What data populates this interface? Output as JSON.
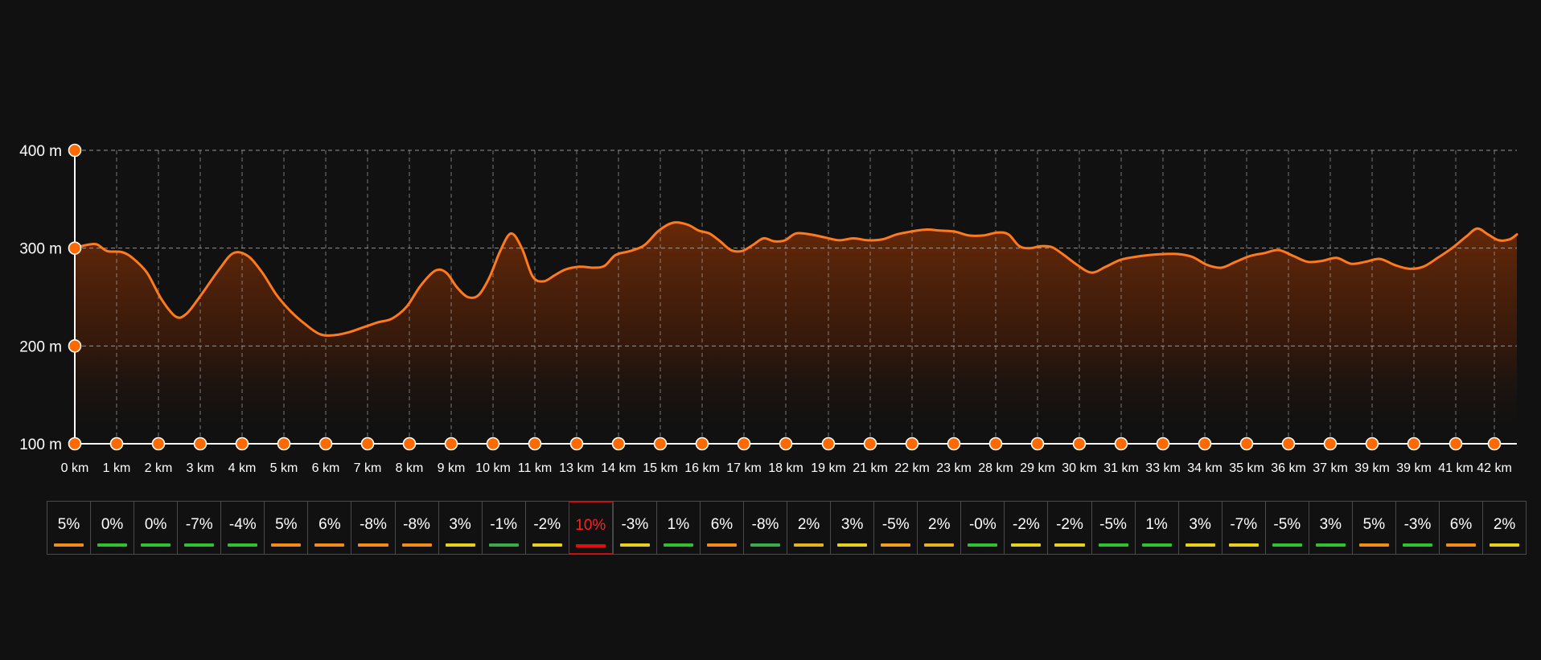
{
  "colors": {
    "background": "#111111",
    "line": "#ff7a1a",
    "marker": "#ff6a00",
    "grid": "#bdbdbd"
  },
  "chart_data": {
    "type": "area",
    "x_unit": "km",
    "y_unit": "m",
    "ylim": [
      100,
      400
    ],
    "y_ticks": [
      100,
      200,
      300,
      400
    ],
    "y_tick_labels": [
      "100 m",
      "200 m",
      "300 m",
      "400 m"
    ],
    "x_tick_labels": [
      "0 km",
      "1 km",
      "2 km",
      "3 km",
      "4 km",
      "5 km",
      "6 km",
      "7 km",
      "8 km",
      "9 km",
      "10 km",
      "11 km",
      "13 km",
      "14 km",
      "15 km",
      "16 km",
      "17 km",
      "18 km",
      "19 km",
      "21 km",
      "22 km",
      "23 km",
      "28 km",
      "29 km",
      "30 km",
      "31 km",
      "33 km",
      "34 km",
      "35 km",
      "36 km",
      "37 km",
      "39 km",
      "39 km",
      "41 km",
      "42 km"
    ],
    "grid": true,
    "elevation": [
      [
        0.0,
        300
      ],
      [
        0.3,
        303
      ],
      [
        0.6,
        304
      ],
      [
        0.9,
        297
      ],
      [
        1.3,
        296
      ],
      [
        1.6,
        290
      ],
      [
        2.0,
        275
      ],
      [
        2.4,
        248
      ],
      [
        2.8,
        230
      ],
      [
        3.1,
        233
      ],
      [
        3.5,
        252
      ],
      [
        4.0,
        278
      ],
      [
        4.4,
        295
      ],
      [
        4.8,
        292
      ],
      [
        5.2,
        275
      ],
      [
        5.6,
        252
      ],
      [
        6.0,
        235
      ],
      [
        6.4,
        222
      ],
      [
        6.8,
        212
      ],
      [
        7.2,
        211
      ],
      [
        7.6,
        214
      ],
      [
        8.0,
        219
      ],
      [
        8.4,
        224
      ],
      [
        8.8,
        228
      ],
      [
        9.2,
        240
      ],
      [
        9.6,
        262
      ],
      [
        10.0,
        277
      ],
      [
        10.3,
        275
      ],
      [
        10.6,
        260
      ],
      [
        10.9,
        250
      ],
      [
        11.2,
        252
      ],
      [
        11.5,
        270
      ],
      [
        11.8,
        297
      ],
      [
        12.1,
        315
      ],
      [
        12.4,
        300
      ],
      [
        12.7,
        271
      ],
      [
        13.0,
        266
      ],
      [
        13.3,
        272
      ],
      [
        13.6,
        278
      ],
      [
        14.0,
        281
      ],
      [
        14.4,
        280
      ],
      [
        14.7,
        282
      ],
      [
        15.0,
        293
      ],
      [
        15.4,
        297
      ],
      [
        15.8,
        303
      ],
      [
        16.2,
        318
      ],
      [
        16.6,
        326
      ],
      [
        17.0,
        324
      ],
      [
        17.3,
        318
      ],
      [
        17.6,
        315
      ],
      [
        17.9,
        307
      ],
      [
        18.2,
        298
      ],
      [
        18.5,
        297
      ],
      [
        18.8,
        303
      ],
      [
        19.1,
        310
      ],
      [
        19.4,
        307
      ],
      [
        19.7,
        308
      ],
      [
        20.0,
        315
      ],
      [
        20.4,
        314
      ],
      [
        20.8,
        311
      ],
      [
        21.2,
        308
      ],
      [
        21.6,
        310
      ],
      [
        22.0,
        308
      ],
      [
        22.4,
        309
      ],
      [
        22.8,
        314
      ],
      [
        23.2,
        317
      ],
      [
        23.6,
        319
      ],
      [
        24.0,
        318
      ],
      [
        24.4,
        317
      ],
      [
        24.8,
        313
      ],
      [
        25.2,
        313
      ],
      [
        25.6,
        316
      ],
      [
        25.9,
        314
      ],
      [
        26.2,
        302
      ],
      [
        26.5,
        300
      ],
      [
        26.8,
        302
      ],
      [
        27.1,
        301
      ],
      [
        27.4,
        294
      ],
      [
        27.8,
        283
      ],
      [
        28.2,
        275
      ],
      [
        28.6,
        281
      ],
      [
        29.0,
        288
      ],
      [
        29.4,
        291
      ],
      [
        29.8,
        293
      ],
      [
        30.2,
        294
      ],
      [
        30.6,
        294
      ],
      [
        31.0,
        291
      ],
      [
        31.4,
        283
      ],
      [
        31.8,
        280
      ],
      [
        32.2,
        286
      ],
      [
        32.6,
        292
      ],
      [
        33.0,
        295
      ],
      [
        33.4,
        298
      ],
      [
        33.8,
        292
      ],
      [
        34.2,
        286
      ],
      [
        34.6,
        287
      ],
      [
        35.0,
        290
      ],
      [
        35.4,
        284
      ],
      [
        35.8,
        286
      ],
      [
        36.2,
        289
      ],
      [
        36.6,
        283
      ],
      [
        37.0,
        279
      ],
      [
        37.4,
        281
      ],
      [
        37.8,
        290
      ],
      [
        38.2,
        300
      ],
      [
        38.6,
        312
      ],
      [
        38.9,
        320
      ],
      [
        39.2,
        314
      ],
      [
        39.5,
        308
      ],
      [
        39.8,
        309
      ],
      [
        40.0,
        314
      ]
    ],
    "grades": [
      {
        "label": "5%",
        "color": "#f08c1a"
      },
      {
        "label": "0%",
        "color": "#2fc12f"
      },
      {
        "label": "0%",
        "color": "#2fc12f"
      },
      {
        "label": "-7%",
        "color": "#2fc12f"
      },
      {
        "label": "-4%",
        "color": "#2fc12f"
      },
      {
        "label": "5%",
        "color": "#f08c1a"
      },
      {
        "label": "6%",
        "color": "#f08c1a"
      },
      {
        "label": "-8%",
        "color": "#f08c1a"
      },
      {
        "label": "-8%",
        "color": "#f08c1a"
      },
      {
        "label": "3%",
        "color": "#e6d21a"
      },
      {
        "label": "-1%",
        "color": "#3aaa4a"
      },
      {
        "label": "-2%",
        "color": "#e6d21a"
      },
      {
        "label": "10%",
        "color": "#e01010",
        "highlight": true
      },
      {
        "label": "-3%",
        "color": "#e6d21a"
      },
      {
        "label": "1%",
        "color": "#2fc12f"
      },
      {
        "label": "6%",
        "color": "#f08c1a"
      },
      {
        "label": "-8%",
        "color": "#3aaa4a"
      },
      {
        "label": "2%",
        "color": "#e6b21a"
      },
      {
        "label": "3%",
        "color": "#e6d21a"
      },
      {
        "label": "-5%",
        "color": "#f0a01a"
      },
      {
        "label": "2%",
        "color": "#e6b21a"
      },
      {
        "label": "-0%",
        "color": "#2fc12f"
      },
      {
        "label": "-2%",
        "color": "#e6d21a"
      },
      {
        "label": "-2%",
        "color": "#e6d21a"
      },
      {
        "label": "-5%",
        "color": "#2fc12f"
      },
      {
        "label": "1%",
        "color": "#2fc12f"
      },
      {
        "label": "3%",
        "color": "#e6d21a"
      },
      {
        "label": "-7%",
        "color": "#e6d21a"
      },
      {
        "label": "-5%",
        "color": "#2fc12f"
      },
      {
        "label": "3%",
        "color": "#2fc12f"
      },
      {
        "label": "5%",
        "color": "#f08c1a"
      },
      {
        "label": "-3%",
        "color": "#2fc12f"
      },
      {
        "label": "6%",
        "color": "#f08c1a"
      },
      {
        "label": "2%",
        "color": "#e6d21a"
      }
    ]
  }
}
